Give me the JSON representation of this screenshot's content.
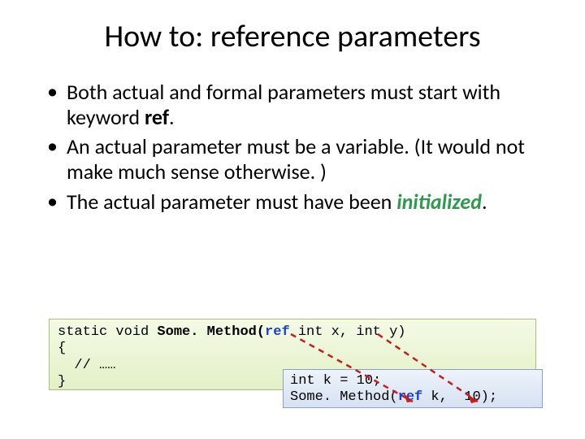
{
  "title": "How to: reference parameters",
  "bullets": {
    "b1a": "Both actual and formal parameters must start with keyword ",
    "b1_ref": "ref",
    "b1b": ".",
    "b2": "An actual parameter must be a variable.  (It would not make much sense otherwise. )",
    "b3a": "The actual parameter must have been ",
    "b3_init": "initialized",
    "b3b": "."
  },
  "code1": {
    "l1a": "static void ",
    "l1b": "Some. Method(",
    "l1_ref": "ref",
    "l1c": " int x, int y)",
    "l2": "{",
    "l3": "  // ……",
    "l4": "}"
  },
  "code2": {
    "l1": "int k = 10;",
    "l2a": "Some. Method(",
    "l2_ref": "ref",
    "l2b": " k,  10);"
  }
}
